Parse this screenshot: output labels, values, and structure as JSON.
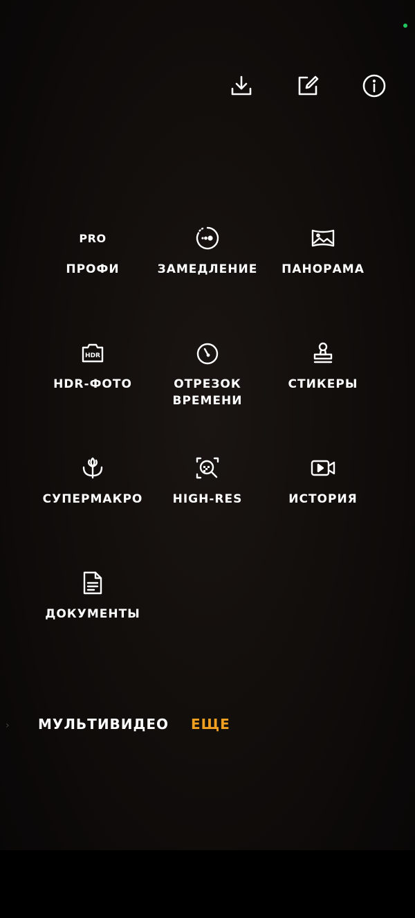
{
  "colors": {
    "accent": "#f0a020",
    "status_dot": "#22c55e",
    "text": "#ffffff"
  },
  "top_icons": [
    {
      "name": "download-icon"
    },
    {
      "name": "edit-icon"
    },
    {
      "name": "info-icon"
    }
  ],
  "modes": [
    {
      "label": "ПРОФИ",
      "icon_text": "PRO"
    },
    {
      "label": "ЗАМЕДЛЕНИЕ"
    },
    {
      "label": "ПАНОРАМА"
    },
    {
      "label": "HDR-ФОТО",
      "icon_text": "HDR"
    },
    {
      "label": "ОТРЕЗОК\nВРЕМЕНИ"
    },
    {
      "label": "СТИКЕРЫ"
    },
    {
      "label": "СУПЕРМАКРО"
    },
    {
      "label": "HIGH-RES"
    },
    {
      "label": "ИСТОРИЯ"
    },
    {
      "label": "ДОКУМЕНТЫ"
    }
  ],
  "tabs": {
    "multivideo": "МУЛЬТИВИДЕО",
    "more": "ЕЩЕ",
    "scroll_indicator": "›"
  }
}
